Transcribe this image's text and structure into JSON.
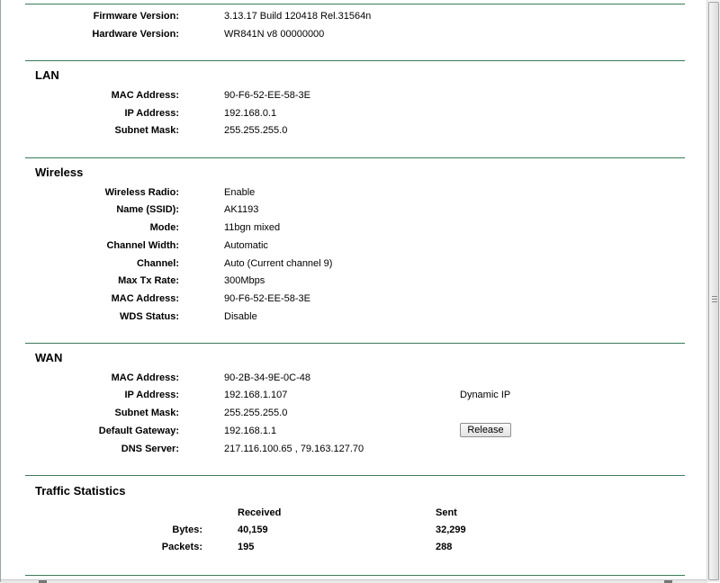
{
  "device": {
    "firmware_label": "Firmware Version:",
    "firmware_value": "3.13.17 Build 120418 Rel.31564n",
    "hardware_label": "Hardware Version:",
    "hardware_value": "WR841N v8 00000000"
  },
  "lan": {
    "title": "LAN",
    "mac_label": "MAC Address:",
    "mac_value": "90-F6-52-EE-58-3E",
    "ip_label": "IP Address:",
    "ip_value": "192.168.0.1",
    "mask_label": "Subnet Mask:",
    "mask_value": "255.255.255.0"
  },
  "wireless": {
    "title": "Wireless",
    "radio_label": "Wireless Radio:",
    "radio_value": "Enable",
    "ssid_label": "Name (SSID):",
    "ssid_value": "AK1193",
    "mode_label": "Mode:",
    "mode_value": "11bgn mixed",
    "width_label": "Channel Width:",
    "width_value": "Automatic",
    "channel_label": "Channel:",
    "channel_value": "Auto (Current channel 9)",
    "rate_label": "Max Tx Rate:",
    "rate_value": "300Mbps",
    "mac_label": "MAC Address:",
    "mac_value": "90-F6-52-EE-58-3E",
    "wds_label": "WDS Status:",
    "wds_value": "Disable"
  },
  "wan": {
    "title": "WAN",
    "mac_label": "MAC Address:",
    "mac_value": "90-2B-34-9E-0C-48",
    "ip_label": "IP Address:",
    "ip_value": "192.168.1.107",
    "ip_type": "Dynamic IP",
    "mask_label": "Subnet Mask:",
    "mask_value": "255.255.255.0",
    "gateway_label": "Default Gateway:",
    "gateway_value": "192.168.1.1",
    "release_label": "Release",
    "dns_label": "DNS Server:",
    "dns_value": "217.116.100.65 , 79.163.127.70"
  },
  "traffic": {
    "title": "Traffic Statistics",
    "received_header": "Received",
    "sent_header": "Sent",
    "bytes_label": "Bytes:",
    "bytes_received": "40,159",
    "bytes_sent": "32,299",
    "packets_label": "Packets:",
    "packets_received": "195",
    "packets_sent": "288"
  },
  "colors": {
    "rule": "#3c7a5a",
    "background": "#ffffff"
  }
}
